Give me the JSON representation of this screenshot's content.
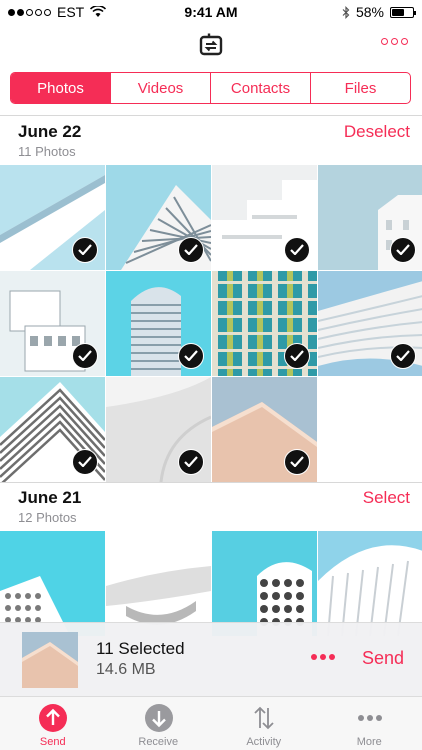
{
  "status_bar": {
    "carrier": "EST",
    "time": "9:41 AM",
    "battery": "58%",
    "battery_level": 0.58,
    "signal_bars": 2
  },
  "header": {
    "logo_icon": "send-anywhere-logo-icon",
    "more_icon": "more-outline-icon"
  },
  "tabs": [
    {
      "label": "Photos",
      "active": true
    },
    {
      "label": "Videos",
      "active": false
    },
    {
      "label": "Contacts",
      "active": false
    },
    {
      "label": "Files",
      "active": false
    }
  ],
  "sections": [
    {
      "title": "June 22",
      "subtitle": "11 Photos",
      "action": "Deselect",
      "photos": [
        {
          "palette": [
            "#b9e2ee",
            "#ffffff",
            "#9bbfd0"
          ],
          "style": "diagonal",
          "selected": true
        },
        {
          "palette": [
            "#9ed9e8",
            "#f4f4f4",
            "#7d8e99"
          ],
          "style": "tower-grid",
          "selected": true
        },
        {
          "palette": [
            "#eef0f1",
            "#ffffff",
            "#d4d8da"
          ],
          "style": "steps",
          "selected": true
        },
        {
          "palette": [
            "#b4d3de",
            "#f7f7f7",
            "#c9d1d5"
          ],
          "style": "block",
          "selected": true
        },
        {
          "palette": [
            "#eaf1f3",
            "#ffffff",
            "#9aa6ac"
          ],
          "style": "cubes",
          "selected": true
        },
        {
          "palette": [
            "#5cd3e6",
            "#d9e3ea",
            "#6e8794"
          ],
          "style": "glass-tower",
          "selected": true
        },
        {
          "palette": [
            "#2f9aa7",
            "#e4e0d0",
            "#b2c45e"
          ],
          "style": "facade",
          "selected": true
        },
        {
          "palette": [
            "#9cc9e2",
            "#f2f2f2",
            "#c7d3da"
          ],
          "style": "waves",
          "selected": true
        },
        {
          "palette": [
            "#a5dfe8",
            "#ffffff",
            "#6e6e6e"
          ],
          "style": "stripes",
          "selected": true
        },
        {
          "palette": [
            "#f3f3f3",
            "#e2e2e2",
            "#cfcfcf"
          ],
          "style": "curve",
          "selected": true
        },
        {
          "palette": [
            "#a9c1d2",
            "#e8c3ad",
            "#f6dfcf"
          ],
          "style": "corner",
          "selected": true
        }
      ]
    },
    {
      "title": "June 21",
      "subtitle": "12 Photos",
      "action": "Select",
      "photos": [
        {
          "palette": [
            "#4fd3e6",
            "#ffffff",
            "#7a7a7a"
          ],
          "style": "pattern",
          "selected": false
        },
        {
          "palette": [
            "#ffffff",
            "#dedede",
            "#b8b8b8"
          ],
          "style": "saucer",
          "selected": false
        },
        {
          "palette": [
            "#57cfe2",
            "#ffffff",
            "#444444"
          ],
          "style": "dots-tower",
          "selected": false
        },
        {
          "palette": [
            "#8fd3ea",
            "#ffffff",
            "#c9cfd4"
          ],
          "style": "dome",
          "selected": false
        }
      ]
    }
  ],
  "send_bar": {
    "selected_count": "11 Selected",
    "total_size": "14.6 MB",
    "send_label": "Send",
    "more_icon": "more-dots-icon"
  },
  "tab_bar": [
    {
      "label": "Send",
      "icon": "send-up-arrow-icon",
      "active": true
    },
    {
      "label": "Receive",
      "icon": "receive-down-arrow-icon",
      "active": false
    },
    {
      "label": "Activity",
      "icon": "activity-arrows-icon",
      "active": false
    },
    {
      "label": "More",
      "icon": "more-dots-icon",
      "active": false
    }
  ],
  "colors": {
    "accent": "#f52d56",
    "check": "#111111",
    "muted": "#8e8e93"
  }
}
